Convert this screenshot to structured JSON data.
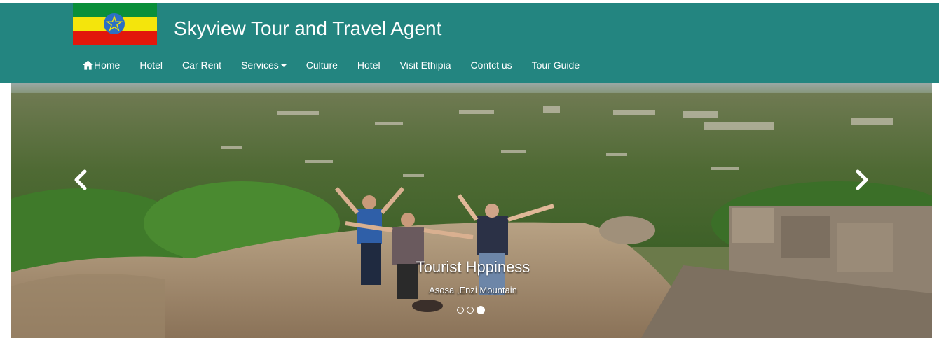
{
  "header": {
    "brand_title": "Skyview Tour and Travel Agent",
    "flag_colors": [
      "#0a8f3a",
      "#f4e50c",
      "#e2170b"
    ],
    "emblem_color": "#2c6fc4",
    "background_color": "#238580"
  },
  "nav": {
    "items": [
      {
        "label": "Home",
        "icon": "home-icon"
      },
      {
        "label": "Hotel"
      },
      {
        "label": "Car Rent"
      },
      {
        "label": "Services",
        "dropdown": true
      },
      {
        "label": "Culture"
      },
      {
        "label": "Hotel"
      },
      {
        "label": "Visit Ethipia"
      },
      {
        "label": "Contct us"
      },
      {
        "label": "Tour Guide"
      }
    ]
  },
  "carousel": {
    "caption_title": "Tourist Hppiness",
    "caption_subtitle": "Asosa ,Enzi Mountain",
    "slide_count": 3,
    "active_slide": 3,
    "prev_icon": "chevron-left-icon",
    "next_icon": "chevron-right-icon"
  }
}
